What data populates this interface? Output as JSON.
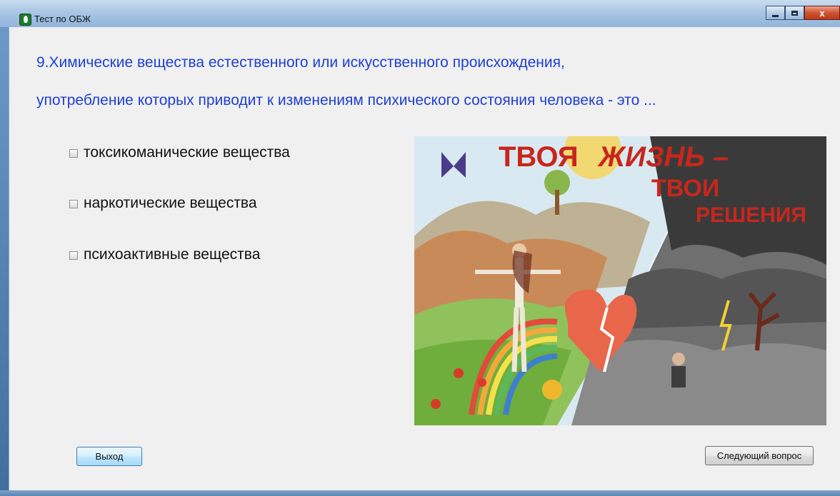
{
  "window": {
    "title": "Тест по ОБЖ",
    "minimize_icon": "minimize-icon",
    "maximize_icon": "maximize-icon",
    "close_icon": "close-icon",
    "close_glyph": "x"
  },
  "question": {
    "line1": "9.Химические вещества естественного или искусственного происхождения,",
    "line2": "употребление которых приводит к изменениям психического состояния человека - это ..."
  },
  "options": [
    {
      "label": "токсикоманические вещества",
      "checked": false
    },
    {
      "label": "наркотические вещества",
      "checked": false
    },
    {
      "label": "психоактивные вещества",
      "checked": false
    }
  ],
  "poster": {
    "line1": "ТВОЯ",
    "line2": "ЖИЗНЬ –",
    "line3": "ТВОИ",
    "line4": "РЕШЕНИЯ"
  },
  "buttons": {
    "exit_label": "Выход",
    "next_label": "Следующий вопрос"
  },
  "colors": {
    "question_text": "#1f3fd1",
    "client_bg": "#f0f0f0",
    "poster_text": "#c8261c"
  }
}
